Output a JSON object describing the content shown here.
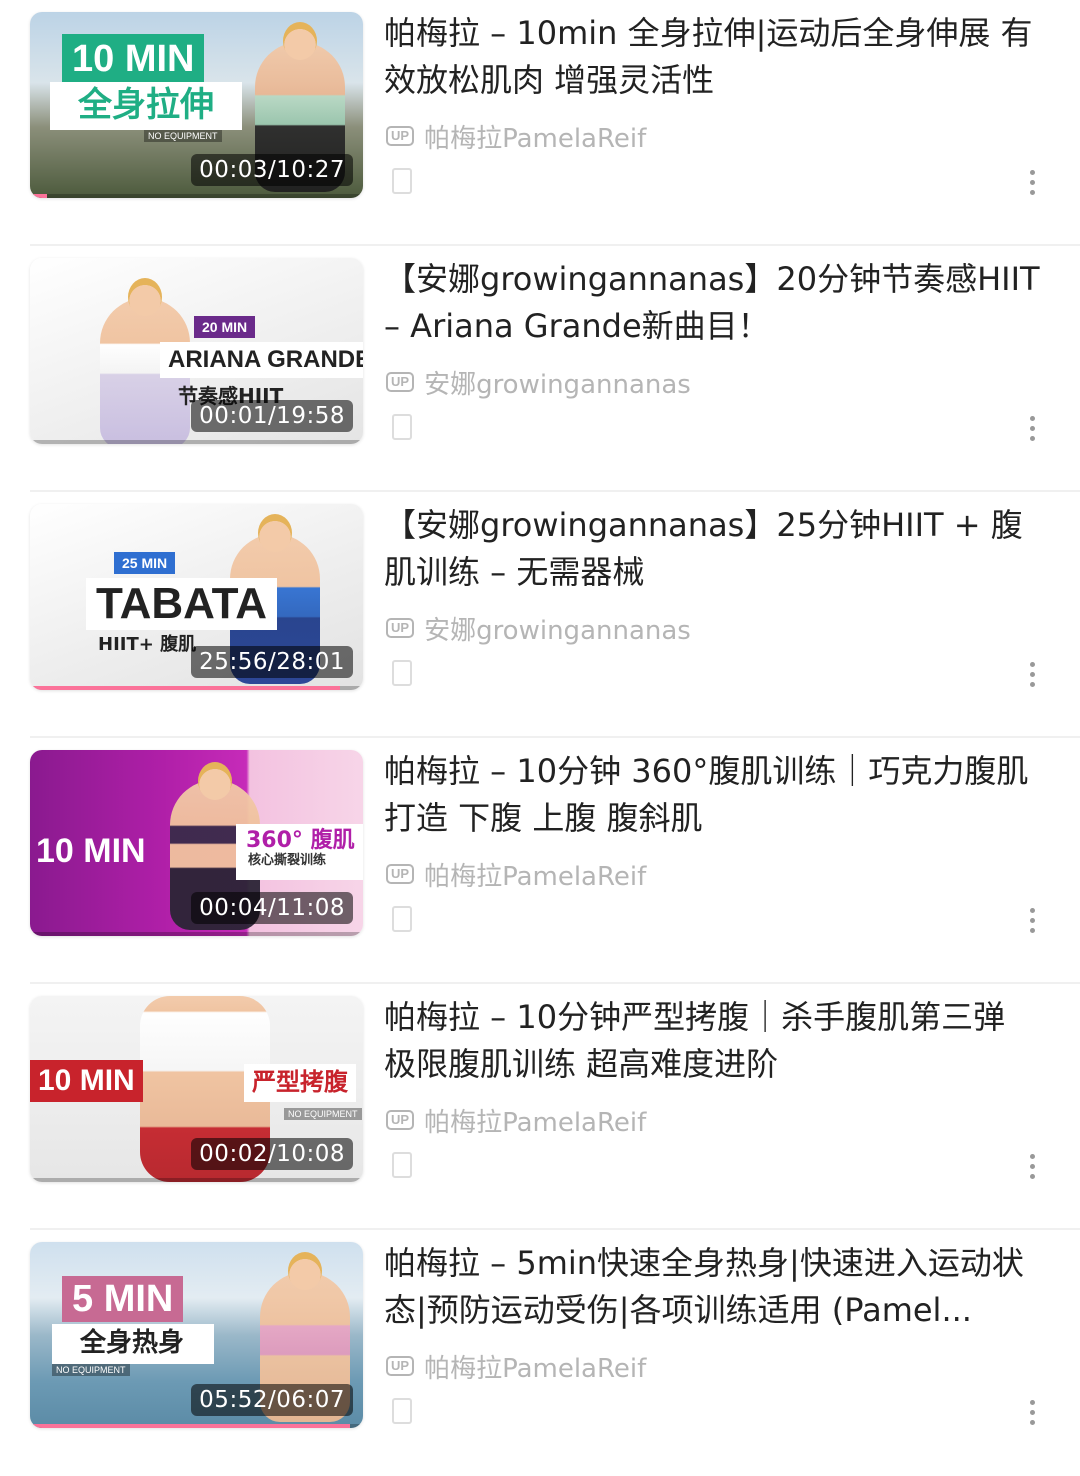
{
  "accent_color": "#fb7299",
  "videos": [
    {
      "title": "帕梅拉 – 10min 全身拉伸|运动后全身伸展 有效放松肌肉 增强灵活性",
      "uploader": "帕梅拉PamelaReif",
      "duration": "00:03/10:27",
      "progress": 0.05,
      "thumb": {
        "big": "10 MIN",
        "sub": "全身拉伸",
        "note": "NO EQUIPMENT"
      }
    },
    {
      "title": "【安娜growingannanas】20分钟节奏感HIIT – Ariana Grande新曲目！",
      "uploader": "安娜growingannanas",
      "duration": "00:01/19:58",
      "progress": 0.01,
      "thumb": {
        "small": "20 MIN",
        "big": "ARIANA GRANDE",
        "sub": "节奏感HIIT"
      }
    },
    {
      "title": "【安娜growingannanas】25分钟HIIT + 腹肌训练 – 无需器械",
      "uploader": "安娜growingannanas",
      "duration": "25:56/28:01",
      "progress": 0.93,
      "thumb": {
        "small": "25 MIN",
        "big": "TABATA",
        "sub": "HIIT+ 腹肌"
      }
    },
    {
      "title": "帕梅拉 – 10分钟 360°腹肌训练｜巧克力腹肌打造 下腹 上腹 腹斜肌",
      "uploader": "帕梅拉PamelaReif",
      "duration": "00:04/11:08",
      "progress": 0.01,
      "thumb": {
        "big": "10 MIN",
        "sub": "360° 腹肌",
        "sub2": "核心撕裂训练"
      }
    },
    {
      "title": "帕梅拉 – 10分钟严型拷腹｜杀手腹肌第三弹 极限腹肌训练 超高难度进阶",
      "uploader": "帕梅拉PamelaReif",
      "duration": "00:02/10:08",
      "progress": 0.01,
      "thumb": {
        "big": "10 MIN",
        "sub": "严型拷腹",
        "note": "NO EQUIPMENT"
      }
    },
    {
      "title": "帕梅拉 – 5min快速全身热身|快速进入运动状态|预防运动受伤|各项训练适用 (Pamel...",
      "uploader": "帕梅拉PamelaReif",
      "duration": "05:52/06:07",
      "progress": 0.96,
      "thumb": {
        "big": "5 MIN",
        "sub": "全身热身",
        "note": "NO EQUIPMENT"
      }
    }
  ]
}
